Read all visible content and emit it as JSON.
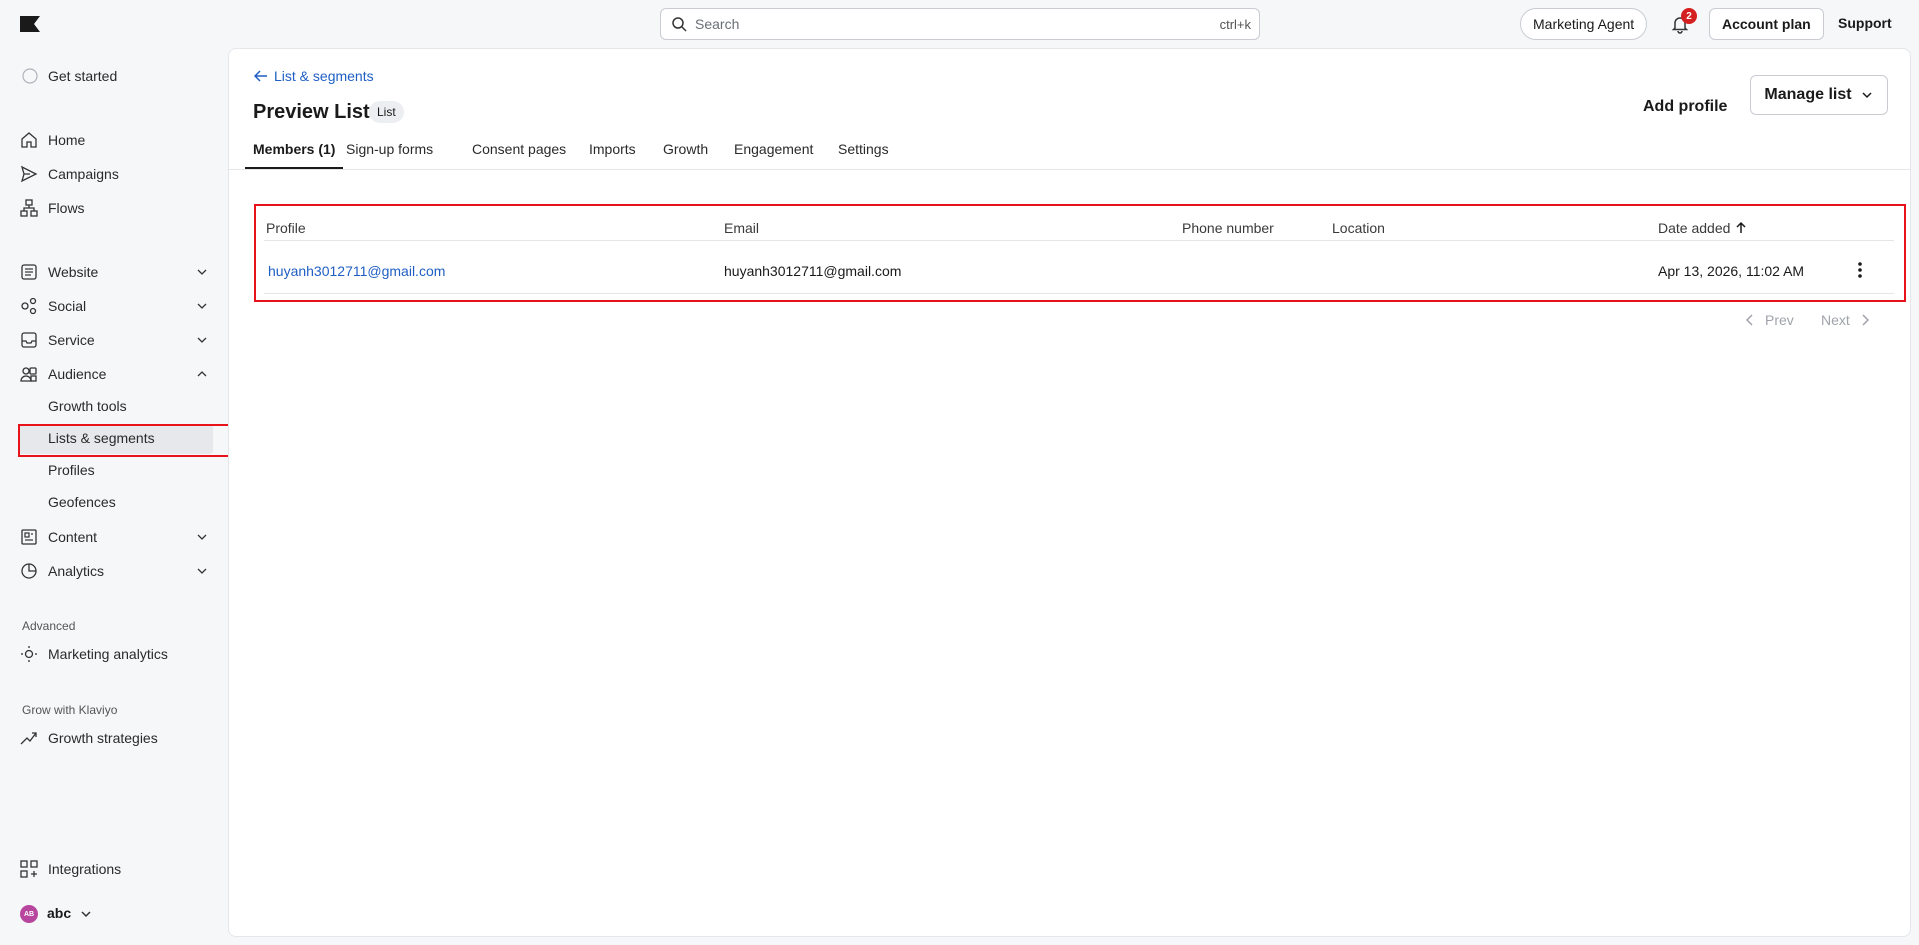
{
  "topbar": {
    "search_placeholder": "Search",
    "search_shortcut": "ctrl+k",
    "marketing_agent": "Marketing Agent",
    "notifications_count": "2",
    "account_plan": "Account plan",
    "support": "Support"
  },
  "sidebar": {
    "get_started": "Get started",
    "home": "Home",
    "campaigns": "Campaigns",
    "flows": "Flows",
    "website": "Website",
    "social": "Social",
    "service": "Service",
    "audience": "Audience",
    "growth_tools": "Growth tools",
    "lists_segments": "Lists & segments",
    "profiles": "Profiles",
    "geofences": "Geofences",
    "content": "Content",
    "analytics": "Analytics",
    "advanced_label": "Advanced",
    "marketing_analytics": "Marketing analytics",
    "grow_label": "Grow with Klaviyo",
    "growth_strategies": "Growth strategies",
    "integrations": "Integrations",
    "account_initials": "AB",
    "account_name": "abc"
  },
  "header": {
    "back_link": "List & segments",
    "title": "Preview List",
    "badge": "List",
    "add_profile": "Add profile",
    "manage_list": "Manage list"
  },
  "tabs": [
    "Members (1)",
    "Sign-up forms",
    "Consent pages",
    "Imports",
    "Growth",
    "Engagement",
    "Settings"
  ],
  "table": {
    "columns": [
      "Profile",
      "Email",
      "Phone number",
      "Location",
      "Date added"
    ],
    "rows": [
      {
        "profile": "huyanh3012711@gmail.com",
        "email": "huyanh3012711@gmail.com",
        "phone": "",
        "location": "",
        "date_added": "Apr 13, 2026, 11:02 AM"
      }
    ]
  },
  "pagination": {
    "prev": "Prev",
    "next": "Next"
  },
  "colors": {
    "accent_link": "#1f5fc4",
    "highlight": "#e8121a",
    "badge": "#d42020"
  }
}
